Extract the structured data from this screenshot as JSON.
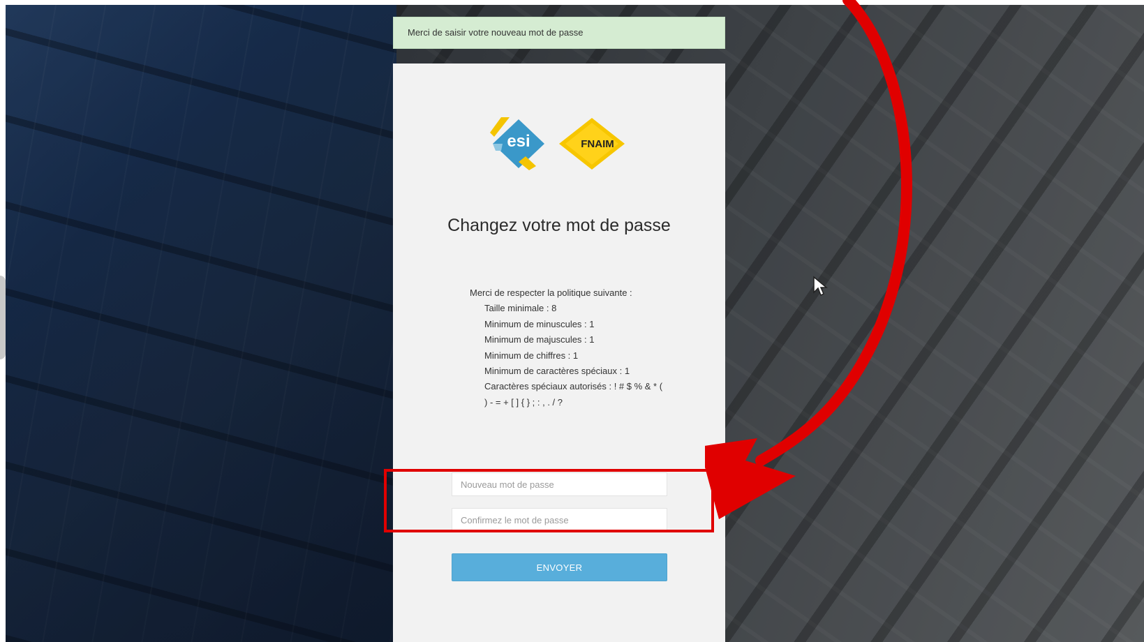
{
  "alert": {
    "message": "Merci de saisir votre nouveau mot de passe"
  },
  "logos": {
    "esi_text": "esi",
    "fnaim_text": "FNAIM"
  },
  "card": {
    "title": "Changez votre mot de passe",
    "policy_intro": "Merci de respecter la politique suivante :",
    "policy_rules": [
      "Taille minimale : 8",
      "Minimum de minuscules : 1",
      "Minimum de majuscules : 1",
      "Minimum de chiffres : 1",
      "Minimum de caractères spéciaux : 1",
      "Caractères spéciaux autorisés : ! # $ % & * ( ) - = + [ ] { } ; : , . / ?"
    ]
  },
  "form": {
    "new_password_placeholder": "Nouveau mot de passe",
    "confirm_password_placeholder": "Confirmez le mot de passe",
    "submit_label": "ENVOYER"
  },
  "colors": {
    "alert_bg": "#d5ecd2",
    "submit_bg": "#58aedb",
    "annotation_red": "#e00000",
    "esi_blue": "#3a98c9",
    "esi_yellow": "#f4c400",
    "fnaim_yellow": "#f7c600"
  }
}
